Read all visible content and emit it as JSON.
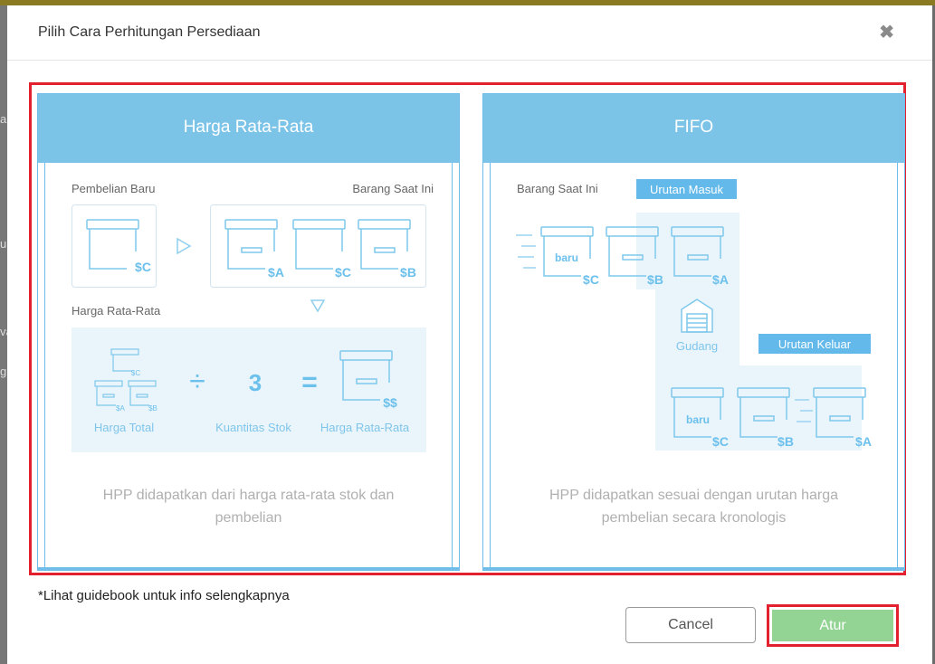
{
  "modal": {
    "title": "Pilih Cara Perhitungan Persediaan",
    "close_symbol": "✖",
    "footnote": "*Lihat guidebook untuk info selengkapnya",
    "cancel_label": "Cancel",
    "submit_label": "Atur"
  },
  "card_average": {
    "title": "Harga Rata-Rata",
    "label_new_purchase": "Pembelian Baru",
    "label_current_stock": "Barang Saat Ini",
    "label_average": "Harga Rata-Rata",
    "new_box_price": "$C",
    "stock_prices": [
      "$A",
      "$C",
      "$B"
    ],
    "formula": {
      "total_label": "Harga Total",
      "mini_prices": [
        "$C",
        "$A",
        "$B"
      ],
      "divide_symbol": "÷",
      "divisor": "3",
      "divisor_label": "Kuantitas Stok",
      "equals_symbol": "=",
      "result_price": "$$",
      "result_label": "Harga Rata-Rata"
    },
    "description_line1": "HPP didapatkan dari harga rata-rata stok dan",
    "description_line2": "pembelian"
  },
  "card_fifo": {
    "title": "FIFO",
    "label_current_stock": "Barang Saat Ini",
    "badge_in": "Urutan Masuk",
    "badge_out": "Urutan Keluar",
    "warehouse_label": "Gudang",
    "new_tag": "baru",
    "top_prices": [
      "$C",
      "$B",
      "$A"
    ],
    "bottom_prices": [
      "$C",
      "$B",
      "$A"
    ],
    "description_line1": "HPP didapatkan sesuai dengan urutan harga",
    "description_line2": "pembelian secara kronologis"
  },
  "background": {
    "fragments": [
      "a",
      "u",
      "va",
      "g"
    ]
  }
}
